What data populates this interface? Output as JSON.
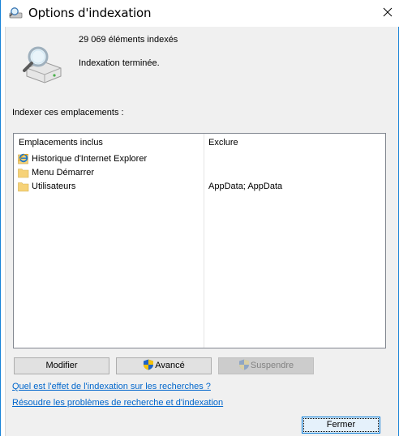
{
  "window": {
    "title": "Options d'indexation",
    "close_icon": "close-icon",
    "title_icon": "indexing-options-icon"
  },
  "status": {
    "icon": "magnifier-drive-icon",
    "count_text": "29 069 éléments indexés",
    "state_text": "Indexation terminée."
  },
  "locations": {
    "section_label": "Indexer ces emplacements :",
    "columns": {
      "included": "Emplacements inclus",
      "exclude": "Exclure"
    },
    "rows": [
      {
        "name": "Historique d'Internet Explorer",
        "exclude": "",
        "icon": "internet-explorer-icon"
      },
      {
        "name": "Menu Démarrer",
        "exclude": "",
        "icon": "folder-icon"
      },
      {
        "name": "Utilisateurs",
        "exclude": "AppData; AppData",
        "icon": "folder-icon"
      }
    ]
  },
  "buttons": {
    "modify": "Modifier",
    "advanced": "Avancé",
    "suspend": "Suspendre",
    "close": "Fermer"
  },
  "links": {
    "effect": "Quel est l'effet de l'indexation sur les recherches ?",
    "troubleshoot": "Résoudre les problèmes de recherche et d'indexation"
  },
  "colors": {
    "accent": "#0078d7",
    "link": "#0066cc",
    "folder": "#f6d278"
  }
}
